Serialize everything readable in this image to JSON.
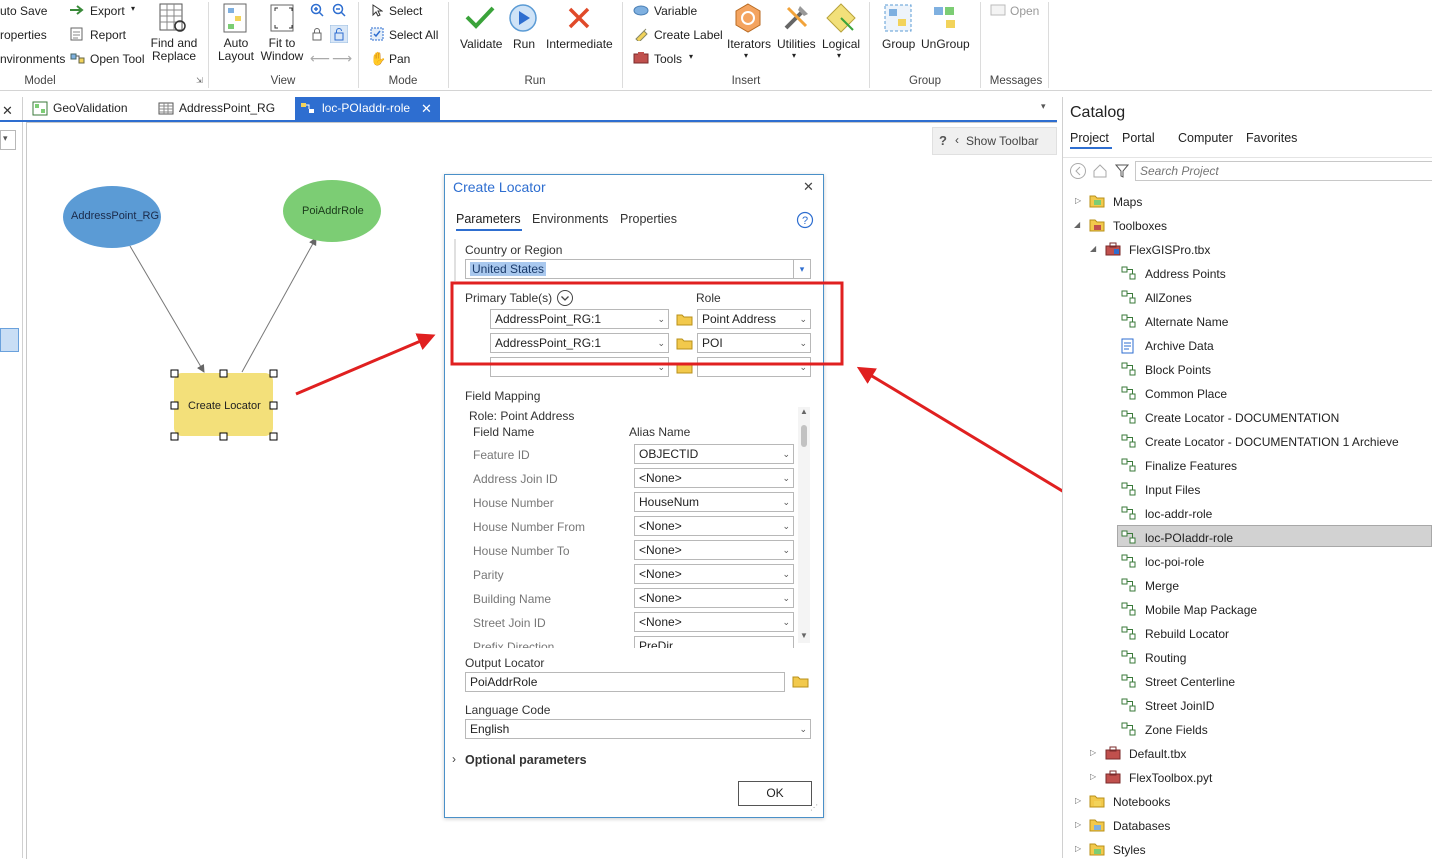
{
  "ribbon": {
    "model": {
      "auto_save": "uto Save",
      "properties": "roperties",
      "environments": "nvironments",
      "export": "Export",
      "report": "Report",
      "open_tool": "Open Tool",
      "find_replace_1": "Find and",
      "find_replace_2": "Replace",
      "label": "Model"
    },
    "view": {
      "auto_layout_1": "Auto",
      "auto_layout_2": "Layout",
      "fit_1": "Fit to",
      "fit_2": "Window",
      "label": "View"
    },
    "mode": {
      "select": "Select",
      "select_all": "Select All",
      "pan": "Pan",
      "label": "Mode"
    },
    "run": {
      "validate": "Validate",
      "run": "Run",
      "intermediate": "Intermediate",
      "label": "Run"
    },
    "insert": {
      "variable": "Variable",
      "create_label": "Create Label",
      "tools": "Tools",
      "iterators": "Iterators",
      "utilities": "Utilities",
      "logical": "Logical",
      "label": "Insert"
    },
    "group": {
      "group": "Group",
      "ungroup": "UnGroup",
      "label": "Group"
    },
    "messages": {
      "open": "Open",
      "label": "Messages"
    }
  },
  "tabs": [
    {
      "label": "GeoValidation"
    },
    {
      "label": "AddressPoint_RG"
    },
    {
      "label": "loc-POIaddr-role"
    }
  ],
  "toolbar": {
    "help": "?",
    "show_toolbar": "Show Toolbar"
  },
  "model": {
    "nodes": [
      {
        "label": "AddressPoint_RG",
        "color": "#5b9bd5"
      },
      {
        "label": "PoiAddrRole",
        "color": "#7ccd74"
      },
      {
        "label": "Create Locator",
        "color": "#f3e07a"
      }
    ]
  },
  "dialog": {
    "title": "Create Locator",
    "tabs": [
      "Parameters",
      "Environments",
      "Properties"
    ],
    "country_label": "Country or Region",
    "country_value": "United States",
    "primary_table_label": "Primary Table(s)",
    "role_label": "Role",
    "rows": [
      {
        "table": "AddressPoint_RG:1",
        "role": "Point Address"
      },
      {
        "table": "AddressPoint_RG:1",
        "role": "POI"
      },
      {
        "table": "",
        "role": ""
      }
    ],
    "field_mapping_label": "Field Mapping",
    "role_heading": "Role: Point Address",
    "col_field": "Field Name",
    "col_alias": "Alias Name",
    "fields": [
      {
        "name": "Feature ID",
        "value": "OBJECTID"
      },
      {
        "name": "Address Join ID",
        "value": "<None>"
      },
      {
        "name": "House Number",
        "value": "HouseNum"
      },
      {
        "name": "House Number From",
        "value": "<None>"
      },
      {
        "name": "House Number To",
        "value": "<None>"
      },
      {
        "name": "Parity",
        "value": "<None>"
      },
      {
        "name": "Building Name",
        "value": "<None>"
      },
      {
        "name": "Street Join ID",
        "value": "<None>"
      }
    ],
    "partial_field": "Prefix Direction",
    "partial_value": "PreDir",
    "output_label": "Output Locator",
    "output_value": "PoiAddrRole",
    "language_label": "Language Code",
    "language_value": "English",
    "optional": "Optional parameters",
    "ok": "OK"
  },
  "catalog": {
    "title": "Catalog",
    "tabs": [
      "Project",
      "Portal",
      "Computer",
      "Favorites"
    ],
    "search_placeholder": "Search Project",
    "items": [
      {
        "label": "Maps"
      },
      {
        "label": "Toolboxes"
      },
      {
        "label": "FlexGISPro.tbx"
      },
      {
        "label": "Address Points"
      },
      {
        "label": "AllZones"
      },
      {
        "label": "Alternate Name"
      },
      {
        "label": "Archive Data"
      },
      {
        "label": "Block Points"
      },
      {
        "label": "Common Place"
      },
      {
        "label": "Create Locator - DOCUMENTATION"
      },
      {
        "label": "Create Locator - DOCUMENTATION 1 Archieve"
      },
      {
        "label": "Finalize Features"
      },
      {
        "label": "Input Files"
      },
      {
        "label": "loc-addr-role"
      },
      {
        "label": "loc-POIaddr-role"
      },
      {
        "label": "loc-poi-role"
      },
      {
        "label": "Merge"
      },
      {
        "label": "Mobile Map Package"
      },
      {
        "label": "Rebuild Locator"
      },
      {
        "label": "Routing"
      },
      {
        "label": "Street Centerline"
      },
      {
        "label": "Street JoinID"
      },
      {
        "label": "Zone Fields"
      },
      {
        "label": "Default.tbx"
      },
      {
        "label": "FlexToolbox.pyt"
      },
      {
        "label": "Notebooks"
      },
      {
        "label": "Databases"
      },
      {
        "label": "Styles"
      }
    ]
  },
  "colors": {
    "accent": "#2e6ed0",
    "annotation": "#e02020"
  }
}
